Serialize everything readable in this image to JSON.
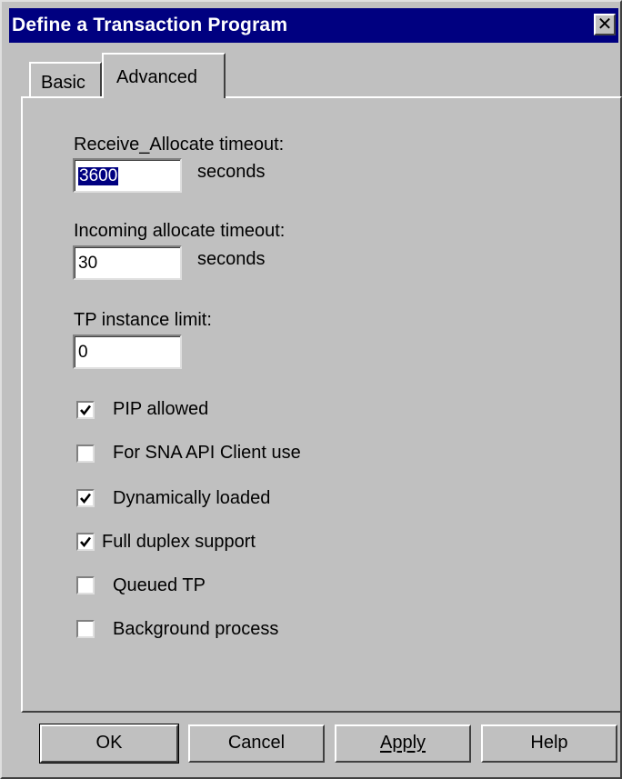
{
  "window": {
    "title": "Define a Transaction Program",
    "close_glyph": "✕"
  },
  "tabs": [
    {
      "label": "Basic",
      "active": false
    },
    {
      "label": "Advanced",
      "active": true
    }
  ],
  "fields": {
    "receive_allocate": {
      "label": "Receive_Allocate timeout:",
      "value": "3600",
      "unit": "seconds"
    },
    "incoming_allocate": {
      "label": "Incoming allocate timeout:",
      "value": "30",
      "unit": "seconds"
    },
    "tp_instance": {
      "label": "TP instance limit:",
      "value": "0"
    }
  },
  "checkboxes": [
    {
      "label": "PIP allowed",
      "checked": true
    },
    {
      "label": "For SNA API Client use",
      "checked": false
    },
    {
      "label": "Dynamically loaded",
      "checked": true
    },
    {
      "label": "Full duplex support",
      "checked": true
    },
    {
      "label": "Queued TP",
      "checked": false
    },
    {
      "label": "Background process",
      "checked": false
    }
  ],
  "buttons": {
    "ok": "OK",
    "cancel": "Cancel",
    "apply": "Apply",
    "help": "Help"
  },
  "colors": {
    "title_bar": "#000080",
    "face": "#c0c0c0",
    "selection": "#000080"
  }
}
